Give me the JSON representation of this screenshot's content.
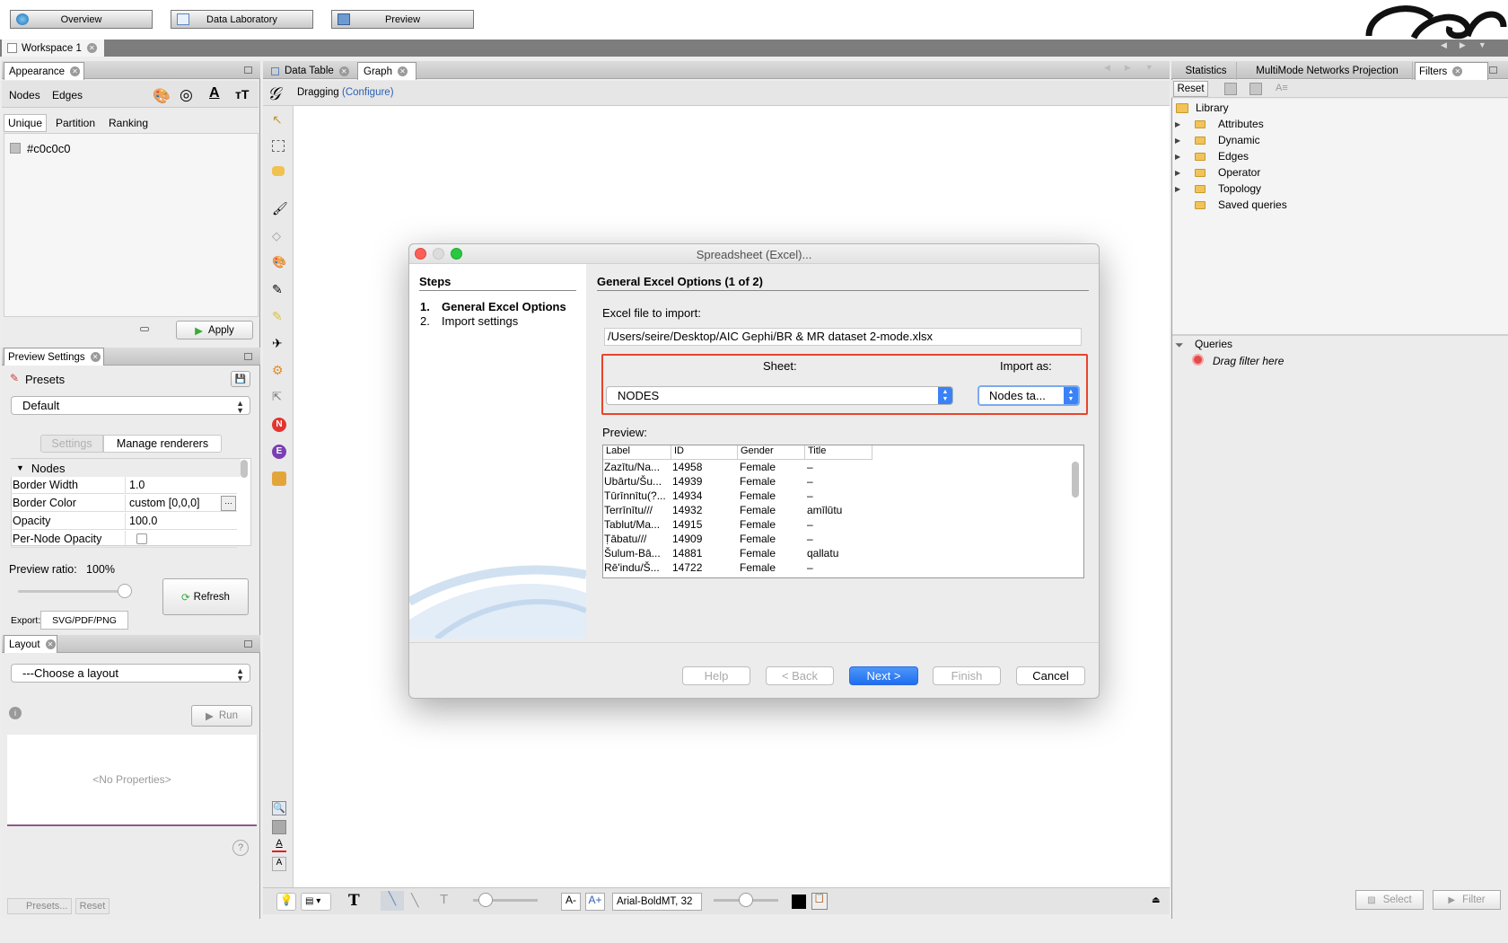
{
  "topbar": {
    "overview": "Overview",
    "data_laboratory": "Data Laboratory",
    "preview": "Preview"
  },
  "workspace_tab": "Workspace 1",
  "appearance": {
    "title": "Appearance",
    "nodes_tab": "Nodes",
    "edges_tab": "Edges",
    "unique": "Unique",
    "partition": "Partition",
    "ranking": "Ranking",
    "color_value": "#c0c0c0",
    "apply": "Apply"
  },
  "preview_settings": {
    "title": "Preview Settings",
    "presets": "Presets",
    "preset_value": "Default",
    "settings_tab": "Settings",
    "manage_renderers": "Manage renderers",
    "group": "Nodes",
    "props": [
      {
        "k": "Border Width",
        "v": "1.0"
      },
      {
        "k": "Border Color",
        "v": "custom [0,0,0]"
      },
      {
        "k": "Opacity",
        "v": "100.0"
      },
      {
        "k": "Per-Node Opacity",
        "v": ""
      }
    ],
    "ratio_label": "Preview ratio:",
    "ratio_value": "100%",
    "refresh": "Refresh",
    "export_label": "Export:",
    "export_btn": "SVG/PDF/PNG"
  },
  "layout": {
    "title": "Layout",
    "choose": "---Choose a layout",
    "run": "Run",
    "no_props": "<No Properties>",
    "presets": "Presets...",
    "reset": "Reset"
  },
  "center_tabs": {
    "data_table": "Data Table",
    "graph": "Graph",
    "mode": "Dragging",
    "configure": "(Configure)"
  },
  "bottom_toolbar": {
    "font": "Arial-BoldMT, 32"
  },
  "right_tabs": {
    "statistics": "Statistics",
    "multimode": "MultiMode Networks Projection",
    "filters": "Filters",
    "reset": "Reset"
  },
  "library": {
    "root": "Library",
    "items": [
      "Attributes",
      "Dynamic",
      "Edges",
      "Operator",
      "Topology",
      "Saved queries"
    ]
  },
  "queries": {
    "title": "Queries",
    "drag": "Drag filter here",
    "select": "Select",
    "filter": "Filter"
  },
  "dialog": {
    "title": "Spreadsheet (Excel)...",
    "steps_title": "Steps",
    "steps": [
      {
        "n": "1.",
        "label": "General Excel Options"
      },
      {
        "n": "2.",
        "label": "Import settings"
      }
    ],
    "heading": "General Excel Options (1 of 2)",
    "file_label": "Excel file to import:",
    "file_path": "/Users/seire/Desktop/AIC Gephi/BR & MR dataset 2-mode.xlsx",
    "sheet_label": "Sheet:",
    "sheet_value": "NODES",
    "import_as_label": "Import as:",
    "import_as_value": "Nodes ta...",
    "preview_label": "Preview:",
    "columns": [
      "Label",
      "ID",
      "Gender",
      "Title"
    ],
    "rows": [
      [
        "Zazītu/Na...",
        "14958",
        "Female",
        "–"
      ],
      [
        "Ubārtu/Šu...",
        "14939",
        "Female",
        "–"
      ],
      [
        "Tūrīnnītu(?...",
        "14934",
        "Female",
        "–"
      ],
      [
        "Terrīnītu///",
        "14932",
        "Female",
        "amīlūtu"
      ],
      [
        "Tablut/Ma...",
        "14915",
        "Female",
        "–"
      ],
      [
        "Ṭābatu///",
        "14909",
        "Female",
        "–"
      ],
      [
        "Šulum-Bā...",
        "14881",
        "Female",
        "qallatu"
      ],
      [
        "Rē'indu/Š...",
        "14722",
        "Female",
        "–"
      ]
    ],
    "buttons": {
      "help": "Help",
      "back": "< Back",
      "next": "Next >",
      "finish": "Finish",
      "cancel": "Cancel"
    }
  }
}
